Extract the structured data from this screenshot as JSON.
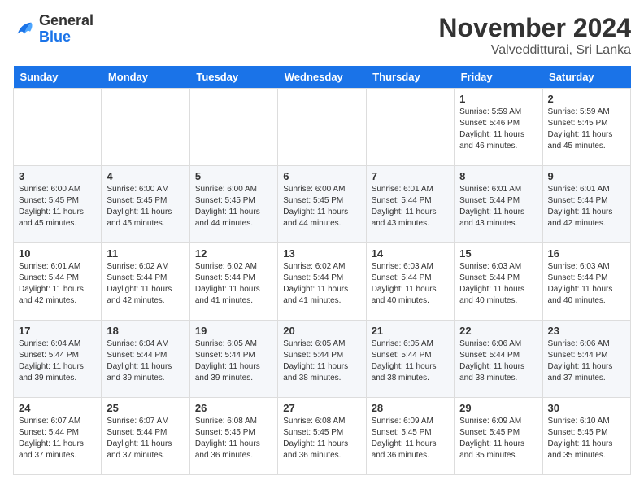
{
  "logo": {
    "general": "General",
    "blue": "Blue"
  },
  "title": "November 2024",
  "subtitle": "Valvedditturai, Sri Lanka",
  "header_days": [
    "Sunday",
    "Monday",
    "Tuesday",
    "Wednesday",
    "Thursday",
    "Friday",
    "Saturday"
  ],
  "weeks": [
    [
      {
        "day": "",
        "info": ""
      },
      {
        "day": "",
        "info": ""
      },
      {
        "day": "",
        "info": ""
      },
      {
        "day": "",
        "info": ""
      },
      {
        "day": "",
        "info": ""
      },
      {
        "day": "1",
        "info": "Sunrise: 5:59 AM\nSunset: 5:46 PM\nDaylight: 11 hours and 46 minutes."
      },
      {
        "day": "2",
        "info": "Sunrise: 5:59 AM\nSunset: 5:45 PM\nDaylight: 11 hours and 45 minutes."
      }
    ],
    [
      {
        "day": "3",
        "info": "Sunrise: 6:00 AM\nSunset: 5:45 PM\nDaylight: 11 hours and 45 minutes."
      },
      {
        "day": "4",
        "info": "Sunrise: 6:00 AM\nSunset: 5:45 PM\nDaylight: 11 hours and 45 minutes."
      },
      {
        "day": "5",
        "info": "Sunrise: 6:00 AM\nSunset: 5:45 PM\nDaylight: 11 hours and 44 minutes."
      },
      {
        "day": "6",
        "info": "Sunrise: 6:00 AM\nSunset: 5:45 PM\nDaylight: 11 hours and 44 minutes."
      },
      {
        "day": "7",
        "info": "Sunrise: 6:01 AM\nSunset: 5:44 PM\nDaylight: 11 hours and 43 minutes."
      },
      {
        "day": "8",
        "info": "Sunrise: 6:01 AM\nSunset: 5:44 PM\nDaylight: 11 hours and 43 minutes."
      },
      {
        "day": "9",
        "info": "Sunrise: 6:01 AM\nSunset: 5:44 PM\nDaylight: 11 hours and 42 minutes."
      }
    ],
    [
      {
        "day": "10",
        "info": "Sunrise: 6:01 AM\nSunset: 5:44 PM\nDaylight: 11 hours and 42 minutes."
      },
      {
        "day": "11",
        "info": "Sunrise: 6:02 AM\nSunset: 5:44 PM\nDaylight: 11 hours and 42 minutes."
      },
      {
        "day": "12",
        "info": "Sunrise: 6:02 AM\nSunset: 5:44 PM\nDaylight: 11 hours and 41 minutes."
      },
      {
        "day": "13",
        "info": "Sunrise: 6:02 AM\nSunset: 5:44 PM\nDaylight: 11 hours and 41 minutes."
      },
      {
        "day": "14",
        "info": "Sunrise: 6:03 AM\nSunset: 5:44 PM\nDaylight: 11 hours and 40 minutes."
      },
      {
        "day": "15",
        "info": "Sunrise: 6:03 AM\nSunset: 5:44 PM\nDaylight: 11 hours and 40 minutes."
      },
      {
        "day": "16",
        "info": "Sunrise: 6:03 AM\nSunset: 5:44 PM\nDaylight: 11 hours and 40 minutes."
      }
    ],
    [
      {
        "day": "17",
        "info": "Sunrise: 6:04 AM\nSunset: 5:44 PM\nDaylight: 11 hours and 39 minutes."
      },
      {
        "day": "18",
        "info": "Sunrise: 6:04 AM\nSunset: 5:44 PM\nDaylight: 11 hours and 39 minutes."
      },
      {
        "day": "19",
        "info": "Sunrise: 6:05 AM\nSunset: 5:44 PM\nDaylight: 11 hours and 39 minutes."
      },
      {
        "day": "20",
        "info": "Sunrise: 6:05 AM\nSunset: 5:44 PM\nDaylight: 11 hours and 38 minutes."
      },
      {
        "day": "21",
        "info": "Sunrise: 6:05 AM\nSunset: 5:44 PM\nDaylight: 11 hours and 38 minutes."
      },
      {
        "day": "22",
        "info": "Sunrise: 6:06 AM\nSunset: 5:44 PM\nDaylight: 11 hours and 38 minutes."
      },
      {
        "day": "23",
        "info": "Sunrise: 6:06 AM\nSunset: 5:44 PM\nDaylight: 11 hours and 37 minutes."
      }
    ],
    [
      {
        "day": "24",
        "info": "Sunrise: 6:07 AM\nSunset: 5:44 PM\nDaylight: 11 hours and 37 minutes."
      },
      {
        "day": "25",
        "info": "Sunrise: 6:07 AM\nSunset: 5:44 PM\nDaylight: 11 hours and 37 minutes."
      },
      {
        "day": "26",
        "info": "Sunrise: 6:08 AM\nSunset: 5:45 PM\nDaylight: 11 hours and 36 minutes."
      },
      {
        "day": "27",
        "info": "Sunrise: 6:08 AM\nSunset: 5:45 PM\nDaylight: 11 hours and 36 minutes."
      },
      {
        "day": "28",
        "info": "Sunrise: 6:09 AM\nSunset: 5:45 PM\nDaylight: 11 hours and 36 minutes."
      },
      {
        "day": "29",
        "info": "Sunrise: 6:09 AM\nSunset: 5:45 PM\nDaylight: 11 hours and 35 minutes."
      },
      {
        "day": "30",
        "info": "Sunrise: 6:10 AM\nSunset: 5:45 PM\nDaylight: 11 hours and 35 minutes."
      }
    ]
  ]
}
